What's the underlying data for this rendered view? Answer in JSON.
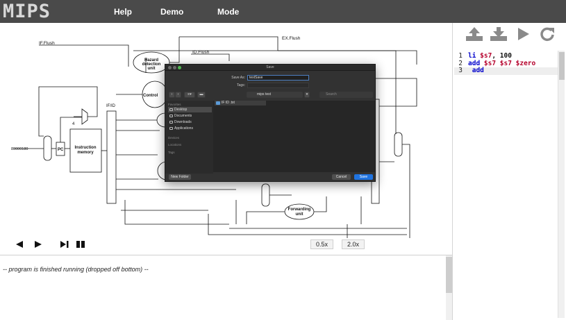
{
  "app": {
    "logo": "MIPS",
    "nav": [
      {
        "label": "Help"
      },
      {
        "label": "Demo"
      },
      {
        "label": "Mode"
      }
    ]
  },
  "toolbar_icons": [
    "upload-icon",
    "download-icon",
    "play-icon",
    "refresh-icon"
  ],
  "code": {
    "lines": [
      {
        "num": "1",
        "parts": [
          {
            "t": "li ",
            "c": "kw"
          },
          {
            "t": "$s7",
            "c": "reg"
          },
          {
            "t": ", ",
            "c": "num"
          },
          {
            "t": "100",
            "c": "num"
          }
        ]
      },
      {
        "num": "2",
        "parts": [
          {
            "t": "add ",
            "c": "kw"
          },
          {
            "t": "$s7 $s7 $zero",
            "c": "reg"
          }
        ]
      },
      {
        "num": "3",
        "parts": [
          {
            "t": " add",
            "c": "kw"
          }
        ]
      }
    ]
  },
  "diagram": {
    "labels": {
      "if_flush": "IF.Flush",
      "id_flush": "ID.Flush",
      "ex_flush": "EX.Flush",
      "hazard": [
        "Hazard",
        "detection",
        "unit"
      ],
      "control": "Control",
      "if_id": "IF/ID",
      "pc": "PC",
      "address": "80000180",
      "four": "4",
      "instruction_memory": [
        "Instruction",
        "memory"
      ],
      "forwarding": [
        "Forwarding",
        "unit"
      ],
      "mux": "M u x"
    }
  },
  "controls": {
    "speed_half": "0.5x",
    "speed_double": "2.0x"
  },
  "console": {
    "text": "-- program is finished running (dropped off bottom) --"
  },
  "dialog": {
    "title": "Save",
    "save_as_label": "Save As:",
    "save_as_value": "testSave",
    "tags_label": "Tags:",
    "location": "mips test",
    "search_placeholder": "Search",
    "favorites_header": "Favorites",
    "devices_header": "Devices",
    "locations_header": "Locations",
    "tags_header": "Tags",
    "sidebar_items": [
      "Desktop",
      "Documents",
      "Downloads",
      "Applications"
    ],
    "file_row": "IF ID .txt",
    "new_folder": "New Folder",
    "cancel": "Cancel",
    "save": "Save",
    "colors": {
      "primary": "#1f73e0"
    }
  }
}
